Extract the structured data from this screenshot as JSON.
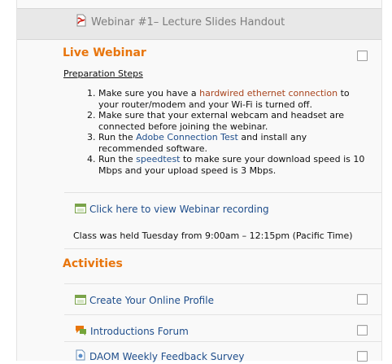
{
  "handout": {
    "title": "Webinar #1– Lecture Slides Handout",
    "icon": "pdf-file-icon"
  },
  "live_webinar": {
    "title": "Live Webinar",
    "preparation_heading": "Preparation Steps",
    "steps": [
      {
        "before": "Make sure you have a ",
        "link": "hardwired ethernet connection",
        "after": " to your router/modem and your Wi-Fi is turned off."
      },
      {
        "before": "Make sure that your external webcam and headset are connected before joining the webinar.",
        "link": "",
        "after": ""
      },
      {
        "before": "Run the ",
        "link": "Adobe Connection Test",
        "after": " and install any recommended software."
      },
      {
        "before": "Run the ",
        "link": "speedtest",
        "after": " to make sure your download speed is 10 Mbps and your upload speed is 3 Mbps."
      }
    ],
    "recording_link": "Click here to view Webinar recording",
    "recording_icon": "page-icon",
    "class_note": "Class was held Tuesday from 9:00am – 12:15pm (Pacific Time)"
  },
  "activities": {
    "title": "Activities",
    "items": [
      {
        "label": "Create Your Online Profile",
        "icon": "page-icon"
      },
      {
        "label": "Introductions Forum",
        "icon": "forum-icon"
      },
      {
        "label": "DAOM Weekly Feedback Survey",
        "icon": "feedback-icon"
      }
    ]
  },
  "colors": {
    "section_title": "#e8750d",
    "link": "#1f4e8c",
    "orange_link": "#a8431c"
  }
}
